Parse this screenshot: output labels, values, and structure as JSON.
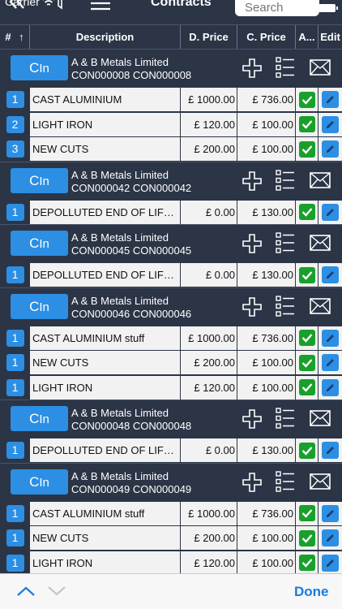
{
  "status": {
    "carrier": "Carrier"
  },
  "nav": {
    "title": "Contracts",
    "search_placeholder": "Search"
  },
  "columns": {
    "num": "#",
    "sort_arrow": "↑",
    "description": "Description",
    "d_price": "D. Price",
    "c_price": "C. Price",
    "a": "A...",
    "edit": "Edit"
  },
  "groups": [
    {
      "button": "In",
      "button_cap": "C",
      "company": "A & B Metals Limited",
      "codes": "CON000008 CON000008",
      "items": [
        {
          "num": "1",
          "description": "CAST ALUMINIUM",
          "d_price": "£ 1000.00",
          "c_price": "£ 736.00"
        },
        {
          "num": "2",
          "description": "LIGHT IRON",
          "d_price": "£ 120.00",
          "c_price": "£ 100.00"
        },
        {
          "num": "3",
          "description": "NEW CUTS",
          "d_price": "£ 200.00",
          "c_price": "£ 100.00"
        }
      ]
    },
    {
      "button": "In",
      "button_cap": "C",
      "company": "A & B Metals Limited",
      "codes": "CON000042 CON000042",
      "items": [
        {
          "num": "1",
          "description": "DEPOLLUTED END OF LIFE VE...",
          "d_price": "£ 0.00",
          "c_price": "£ 130.00"
        }
      ]
    },
    {
      "button": "In",
      "button_cap": "C",
      "company": "A & B Metals Limited",
      "codes": "CON000045 CON000045",
      "items": [
        {
          "num": "1",
          "description": "DEPOLLUTED END OF LIFE VE...",
          "d_price": "£ 0.00",
          "c_price": "£ 130.00"
        }
      ]
    },
    {
      "button": "In",
      "button_cap": "C",
      "company": "A & B Metals Limited",
      "codes": "CON000046 CON000046",
      "items": [
        {
          "num": "1",
          "description": "CAST ALUMINIUM stuff",
          "d_price": "£ 1000.00",
          "c_price": "£ 736.00"
        },
        {
          "num": "1",
          "description": "NEW CUTS",
          "d_price": "£ 200.00",
          "c_price": "£ 100.00"
        },
        {
          "num": "1",
          "description": "LIGHT IRON",
          "d_price": "£ 120.00",
          "c_price": "£ 100.00"
        }
      ]
    },
    {
      "button": "In",
      "button_cap": "C",
      "company": "A & B Metals Limited",
      "codes": "CON000048 CON000048",
      "items": [
        {
          "num": "1",
          "description": "DEPOLLUTED END OF LIFE VE...",
          "d_price": "£ 0.00",
          "c_price": "£ 130.00"
        }
      ]
    },
    {
      "button": "In",
      "button_cap": "C",
      "company": "A & B Metals Limited",
      "codes": "CON000049 CON000049",
      "items": [
        {
          "num": "1",
          "description": "CAST ALUMINIUM stuff",
          "d_price": "£ 1000.00",
          "c_price": "£ 736.00"
        },
        {
          "num": "1",
          "description": "NEW CUTS",
          "d_price": "£ 200.00",
          "c_price": "£ 100.00"
        },
        {
          "num": "1",
          "description": "LIGHT IRON",
          "d_price": "£ 120.00",
          "c_price": "£ 100.00"
        }
      ]
    }
  ],
  "toolbar": {
    "done_label": "Done"
  },
  "colors": {
    "nav_bg": "#2b3546",
    "accent_blue": "#2c8fe3",
    "approve_green": "#18a02a",
    "cell_bg": "#f2f2f2",
    "done_blue": "#1a7ae0"
  },
  "icons": {
    "back": "double-chevron-left-icon",
    "filter": "filter-icon",
    "menu": "hamburger-icon",
    "battery": "battery-icon",
    "add": "plus-icon",
    "details": "list-icon",
    "email": "envelope-icon",
    "approved": "check-icon",
    "edit": "pencil-icon",
    "prev": "chevron-up-icon",
    "next": "chevron-down-icon"
  }
}
